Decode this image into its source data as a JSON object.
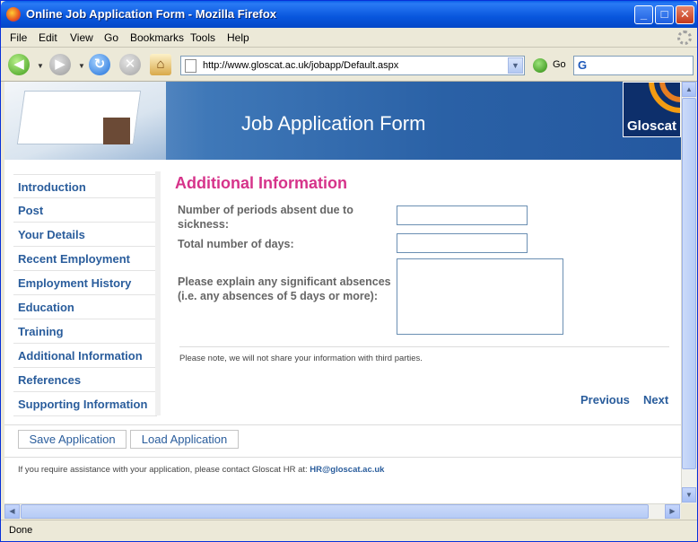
{
  "window": {
    "title": "Online Job Application Form - Mozilla Firefox",
    "min_glyph": "_",
    "max_glyph": "□",
    "close_glyph": "✕"
  },
  "menu": [
    "File",
    "Edit",
    "View",
    "Go",
    "Bookmarks",
    "Tools",
    "Help"
  ],
  "navbar": {
    "url": "http://www.gloscat.ac.uk/jobapp/Default.aspx",
    "go_label": "Go",
    "search_engine_glyph": "G"
  },
  "icons": {
    "back": "back-arrow-icon",
    "forward": "forward-arrow-icon",
    "reload": "reload-icon",
    "stop": "stop-icon",
    "home": "home-icon",
    "go": "go-icon"
  },
  "page": {
    "heading": "Job Application Form",
    "logo_text": "Gloscat",
    "sidebar": [
      "Introduction",
      "Post",
      "Your Details",
      "Recent Employment",
      "Employment History",
      "Education",
      "Training",
      "Additional Information",
      "References",
      "Supporting Information"
    ],
    "section_title": "Additional Information",
    "fields": {
      "absent_periods_label": "Number of periods absent due to sickness:",
      "absent_periods_value": "",
      "total_days_label": "Total number of days:",
      "total_days_value": "",
      "explain_label": "Please explain any significant absences (i.e. any absences of 5 days or more):",
      "explain_value": ""
    },
    "privacy_note": "Please note, we will not share your information with third parties.",
    "previous_label": "Previous",
    "next_label": "Next",
    "save_label": "Save Application",
    "load_label": "Load Application",
    "help_text": "If you require assistance with your application, please contact Gloscat HR at:",
    "help_email": "HR@gloscat.ac.uk"
  },
  "status": {
    "text": "Done"
  },
  "colors": {
    "accent_title": "#d6338a",
    "link_blue": "#2a5d9c",
    "banner_blue": "#2a61a6"
  }
}
